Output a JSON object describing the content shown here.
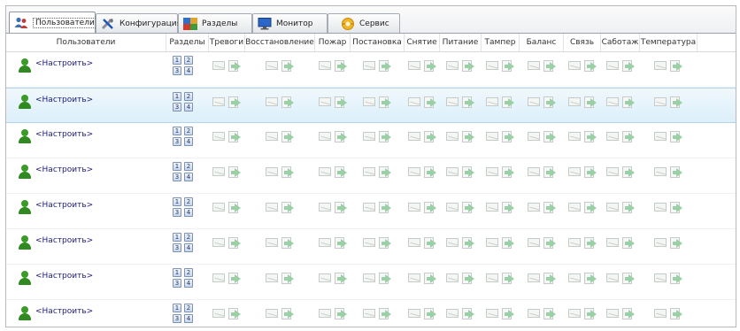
{
  "tabs": [
    {
      "label": "Пользователи",
      "icon": "users-icon",
      "active": true
    },
    {
      "label": "Конфигурация",
      "icon": "tools-icon",
      "active": false
    },
    {
      "label": "Разделы",
      "icon": "partitions-icon",
      "active": false
    },
    {
      "label": "Монитор",
      "icon": "monitor-icon",
      "active": false
    },
    {
      "label": "Сервис",
      "icon": "service-icon",
      "active": false
    }
  ],
  "columns": {
    "users": "Пользователи",
    "partitions": "Разделы",
    "events": [
      "Тревоги",
      "Восстановление",
      "Пожар",
      "Постановка",
      "Снятие",
      "Питание",
      "Тампер",
      "Баланс",
      "Связь",
      "Саботаж",
      "Температура"
    ]
  },
  "partition_numbers": [
    "1",
    "2",
    "3",
    "4"
  ],
  "row_label": "<Настроить>",
  "rows": [
    {
      "user": "<Настроить>",
      "selected": false
    },
    {
      "user": "<Настроить>",
      "selected": true
    },
    {
      "user": "<Настроить>",
      "selected": false
    },
    {
      "user": "<Настроить>",
      "selected": false
    },
    {
      "user": "<Настроить>",
      "selected": false
    },
    {
      "user": "<Настроить>",
      "selected": false
    },
    {
      "user": "<Настроить>",
      "selected": false
    },
    {
      "user": "<Настроить>",
      "selected": false
    }
  ],
  "colors": {
    "accent": "#2f8a1f",
    "selection": "#dceffa",
    "link": "#1a1a80"
  }
}
